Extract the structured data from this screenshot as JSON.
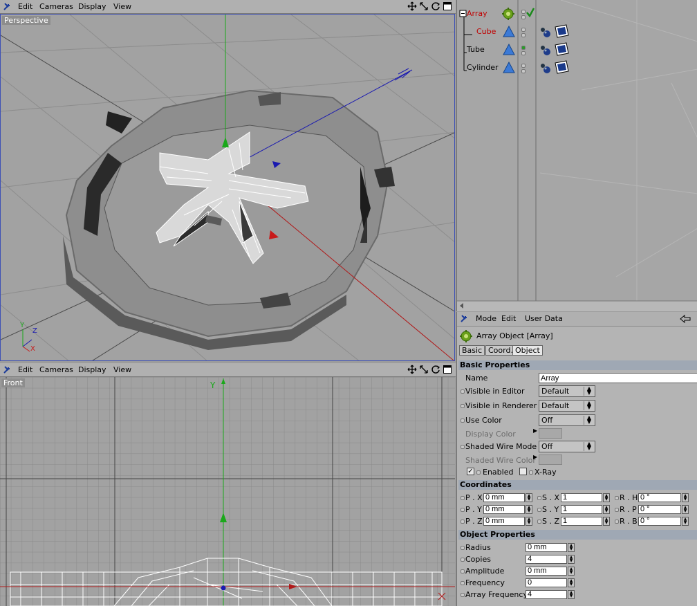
{
  "top_viewport": {
    "menu": [
      "Edit",
      "Cameras",
      "Display",
      "View"
    ],
    "label": "Perspective",
    "axis_labels": {
      "y": "Y",
      "z": "Z",
      "x": "X"
    }
  },
  "bottom_viewport": {
    "menu": [
      "Edit",
      "Cameras",
      "Display",
      "View"
    ],
    "label": "Front",
    "axis_labels": {
      "y": "Y",
      "x": "X"
    }
  },
  "object_manager": {
    "objects": [
      {
        "name": "Array",
        "color": "#c00000"
      },
      {
        "name": "Cube",
        "color": "#c00000"
      },
      {
        "name": "Tube",
        "color": "#000000"
      },
      {
        "name": "Cylinder",
        "color": "#000000"
      }
    ]
  },
  "attribute_manager": {
    "menu": [
      "Mode",
      "Edit",
      "User Data"
    ],
    "title": "Array Object [Array]",
    "tabs": [
      "Basic",
      "Coord.",
      "Object"
    ],
    "basic": {
      "header": "Basic Properties",
      "name_label": "Name",
      "name_value": "Array",
      "visible_editor_label": "Visible in Editor",
      "visible_editor_value": "Default",
      "visible_renderer_label": "Visible in Renderer",
      "visible_renderer_value": "Default",
      "use_color_label": "Use Color",
      "use_color_value": "Off",
      "display_color_label": "Display Color",
      "shaded_wire_label": "Shaded Wire Mode",
      "shaded_wire_value": "Off",
      "shaded_wire_color_label": "Shaded Wire Color",
      "enabled_label": "Enabled",
      "enabled": true,
      "xray_label": "X-Ray",
      "xray": false
    },
    "coords": {
      "header": "Coordinates",
      "px_label": "P . X",
      "px": "0 mm",
      "py_label": "P . Y",
      "py": "0 mm",
      "pz_label": "P . Z",
      "pz": "0 mm",
      "sx_label": "S . X",
      "sx": "1",
      "sy_label": "S . Y",
      "sy": "1",
      "sz_label": "S . Z",
      "sz": "1",
      "rh_label": "R . H",
      "rh": "0 °",
      "rp_label": "R . P",
      "rp": "0 °",
      "rb_label": "R . B",
      "rb": "0 °"
    },
    "object": {
      "header": "Object Properties",
      "radius_label": "Radius",
      "radius": "0 mm",
      "copies_label": "Copies",
      "copies": "4",
      "amplitude_label": "Amplitude",
      "amplitude": "0 mm",
      "frequency_label": "Frequency",
      "frequency": "0",
      "array_freq_label": "Array Frequency",
      "array_freq": "4"
    }
  }
}
